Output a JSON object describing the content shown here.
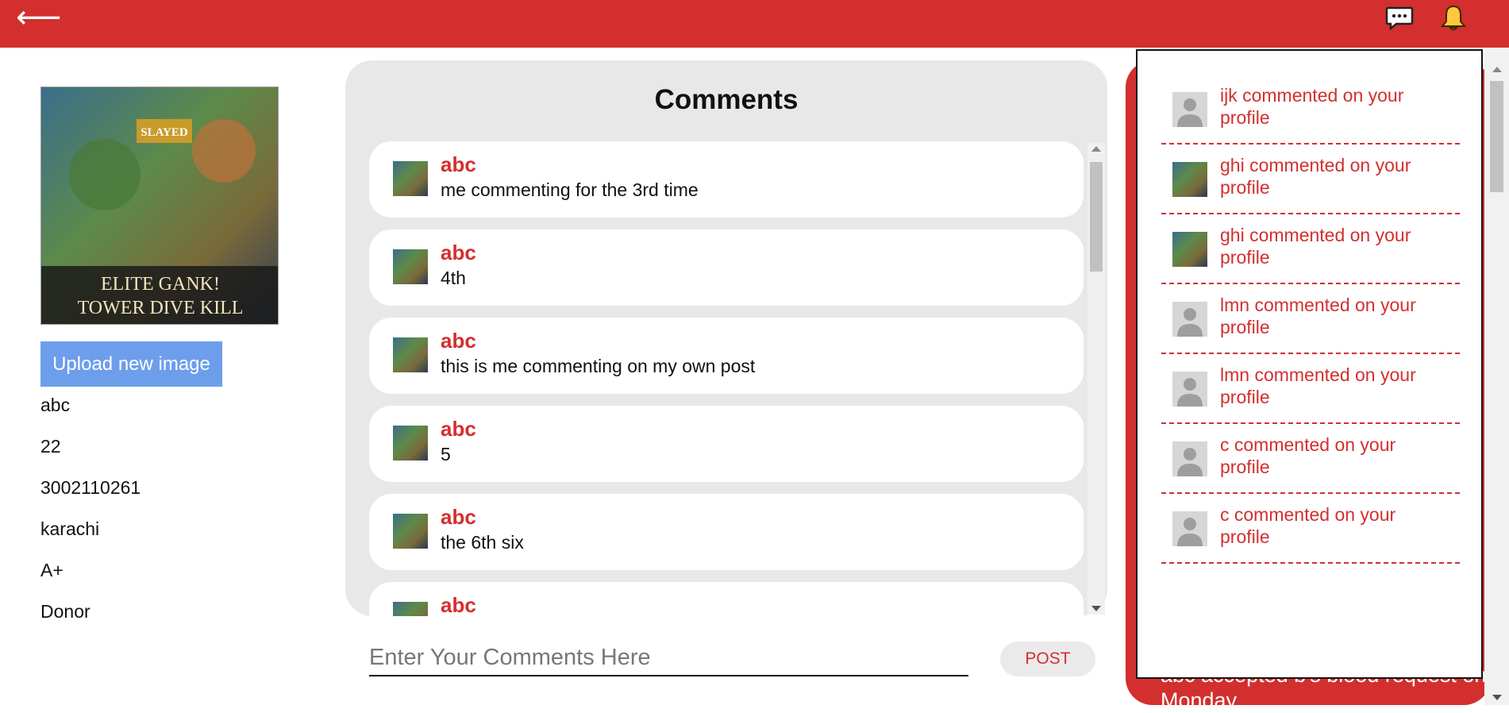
{
  "colors": {
    "brand": "#d32f2f",
    "upload": "#6d9eeb",
    "panel": "#e8e8e8"
  },
  "header": {
    "back_glyph": "⟵",
    "back_icon": "arrow-left-icon",
    "message_icon": "chat-bubble-icon",
    "bell_icon": "bell-icon"
  },
  "profile": {
    "image_caption_1": "ELITE GANK!",
    "image_caption_2": "TOWER DIVE KILL",
    "image_banner": "SLAYED",
    "upload_label": "Upload new image",
    "fields": [
      "abc",
      "22",
      "3002110261",
      "karachi",
      "A+",
      "Donor"
    ]
  },
  "comments": {
    "title": "Comments",
    "items": [
      {
        "author": "abc",
        "text": "me commenting for the 3rd time"
      },
      {
        "author": "abc",
        "text": "4th"
      },
      {
        "author": "abc",
        "text": "this is me commenting on my own post"
      },
      {
        "author": "abc",
        "text": "5"
      },
      {
        "author": "abc",
        "text": "the 6th six"
      },
      {
        "author": "abc",
        "text": ""
      }
    ],
    "input_placeholder": "Enter Your Comments Here",
    "post_label": "POST"
  },
  "right_panel": {
    "text": "abc accepted b's blood request on Monday"
  },
  "notifications": {
    "items": [
      {
        "text": "ijk commented on your profile",
        "avatar": "default"
      },
      {
        "text": "ghi commented on your profile",
        "avatar": "game"
      },
      {
        "text": "ghi commented on your profile",
        "avatar": "game"
      },
      {
        "text": "lmn commented on your profile",
        "avatar": "default"
      },
      {
        "text": "lmn commented on your profile",
        "avatar": "default"
      },
      {
        "text": "c commented on your profile",
        "avatar": "default"
      },
      {
        "text": "c commented on your profile",
        "avatar": "default"
      }
    ]
  }
}
